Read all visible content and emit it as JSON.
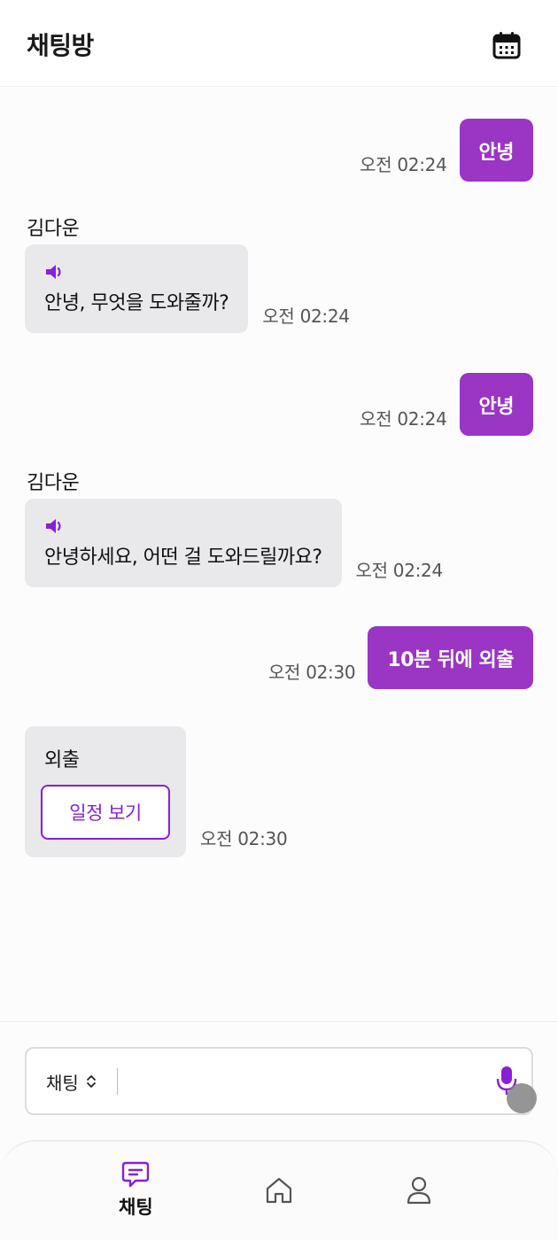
{
  "header": {
    "title": "채팅방",
    "calendar_icon": "calendar-icon"
  },
  "messages": {
    "m1": {
      "text": "안녕",
      "time": "오전 02:24"
    },
    "m2": {
      "sender": "김다운",
      "text": "안녕, 무엇을 도와줄까?",
      "time": "오전 02:24"
    },
    "m3": {
      "text": "안녕",
      "time": "오전 02:24"
    },
    "m4": {
      "sender": "김다운",
      "text": "안녕하세요, 어떤 걸 도와드릴까요?",
      "time": "오전 02:24"
    },
    "m5": {
      "text": "10분 뒤에 외출",
      "time": "오전 02:30"
    },
    "m6": {
      "text": "외출",
      "button_label": "일정 보기",
      "time": "오전 02:30"
    }
  },
  "input": {
    "mode_label": "채팅",
    "value": "",
    "mic_icon": "mic-icon"
  },
  "nav": {
    "chat_label": "채팅",
    "home_icon": "home-icon",
    "profile_icon": "profile-icon"
  },
  "colors": {
    "accent": "#9a35c4",
    "accent_outline": "#8a1fd6",
    "bot_bubble": "#e9e8eb",
    "background": "#fcfcfd"
  }
}
